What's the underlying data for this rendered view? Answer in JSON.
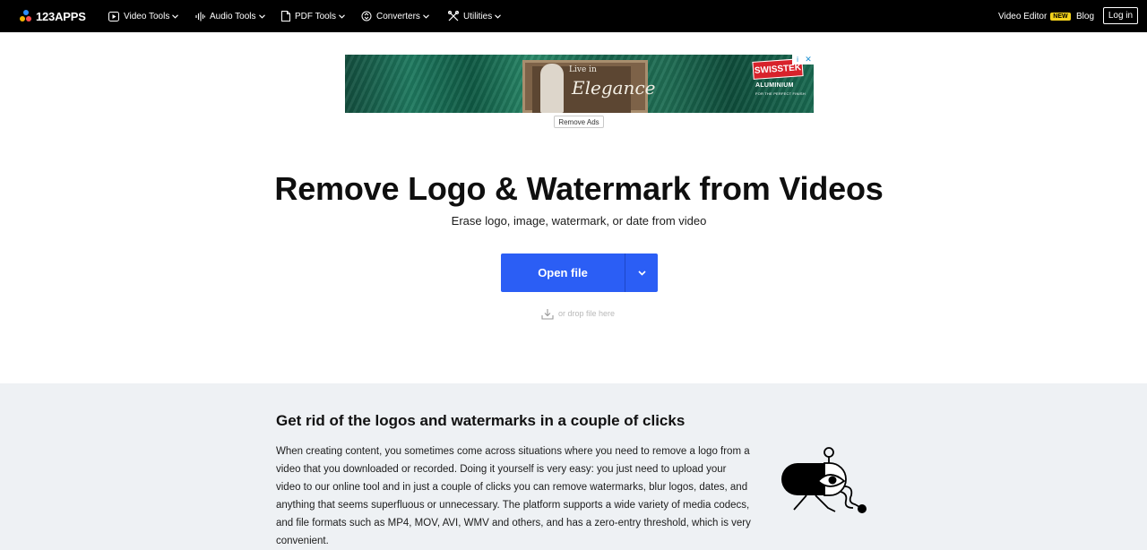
{
  "nav": {
    "logo_text": "123APPS",
    "items": [
      {
        "label": "Video Tools",
        "icon": "video-icon"
      },
      {
        "label": "Audio Tools",
        "icon": "audio-wave-icon"
      },
      {
        "label": "PDF Tools",
        "icon": "pdf-file-icon"
      },
      {
        "label": "Converters",
        "icon": "convert-icon"
      },
      {
        "label": "Utilities",
        "icon": "tools-icon"
      }
    ],
    "video_editor": "Video Editor",
    "new_badge": "NEW",
    "blog": "Blog",
    "login": "Log in"
  },
  "ad": {
    "headline_small": "Live in",
    "headline_big": "Elegance",
    "brand": "SWISSTEK",
    "brand_sub": "ALUMINIUM",
    "brand_sub2": "FOR THE PERFECT FINISH",
    "remove_ads": "Remove Ads"
  },
  "hero": {
    "title": "Remove Logo & Watermark from Videos",
    "subtitle": "Erase logo, image, watermark, or date from video",
    "open_file": "Open file",
    "drop_hint": "or drop file here"
  },
  "section": {
    "title": "Get rid of the logos and watermarks in a couple of clicks",
    "body": "When creating content, you sometimes come across situations where you need to remove a logo from a video that you downloaded or recorded. Doing it yourself is very easy: you just need to upload your video to our online tool and in just a couple of clicks you can remove watermarks, blur logos, dates, and anything that seems superfluous or unnecessary. The platform supports a wide variety of media codecs, and file formats such as MP4, MOV, AVI, WMV and others, and has a zero-entry threshold, which is very convenient."
  },
  "colors": {
    "nav_bg": "#000000",
    "primary": "#2b5ef5",
    "section_bg": "#eef1f4",
    "badge": "#f3d21b"
  }
}
